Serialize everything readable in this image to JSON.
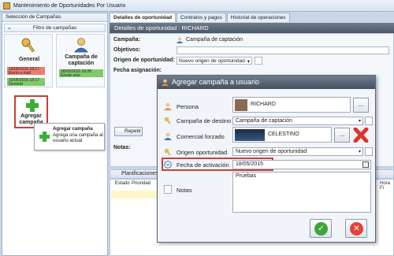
{
  "window": {
    "title": "Mantenimiento de Oportunidades Por Usuario"
  },
  "left": {
    "header": "Selección de Campañas",
    "filter_label": "Filtro de campañas",
    "cards": [
      {
        "name": "General",
        "badge_red_date": "15/05/2015 18:17",
        "badge_red_text": "Envío e-mail",
        "badge_green_date": "15/05/2015 18:17",
        "badge_green_text": "General"
      },
      {
        "name": "Campaña de captación",
        "badge_green_date": "18/05/2015 18:28",
        "badge_green_text": "Enviar sms"
      }
    ],
    "add_card_label": "Agregar campaña",
    "tooltip": {
      "title": "Agregar campaña",
      "text": "Agrega una campaña al usuario actual"
    }
  },
  "tabs": [
    "Detalles de oportunidad",
    "Contratos y pagos",
    "Historial de operaciones"
  ],
  "detail": {
    "header": "Detalles de oportunidad : RICHARD",
    "fields": {
      "campana_label": "Campaña:",
      "campana_value": "Campaña de captación",
      "objetivos_label": "Objetivos:",
      "origen_label": "Origen de oportunidad:",
      "origen_value": "Nuevo origen de oportunidad",
      "fecha_label": "Fecha asignación:"
    },
    "repetir_label": "Repetir",
    "notas_label": "Notas:"
  },
  "planificaciones": {
    "label": "Planificaciones",
    "columns": [
      "Estado",
      "Prioridad",
      "Hora Fi"
    ]
  },
  "modal": {
    "title": "Agregar campaña a usuario",
    "persona_label": "Persona",
    "persona_value": "RICHARD",
    "destino_label": "Campaña de destino",
    "destino_value": "Campaña de captación",
    "comercial_label": "Comercial forzado",
    "comercial_value": "CELESTINO",
    "origen_label": "Origen oportunidad",
    "origen_value": "Nuevo origen de oportunidad",
    "fecha_label": "Fecha de activación",
    "fecha_value": "18/05/2015",
    "notas_label": "Notas",
    "notas_value": "Pruebas",
    "ellipsis": "...",
    "ok_glyph": "✓",
    "cancel_glyph": "✕"
  }
}
